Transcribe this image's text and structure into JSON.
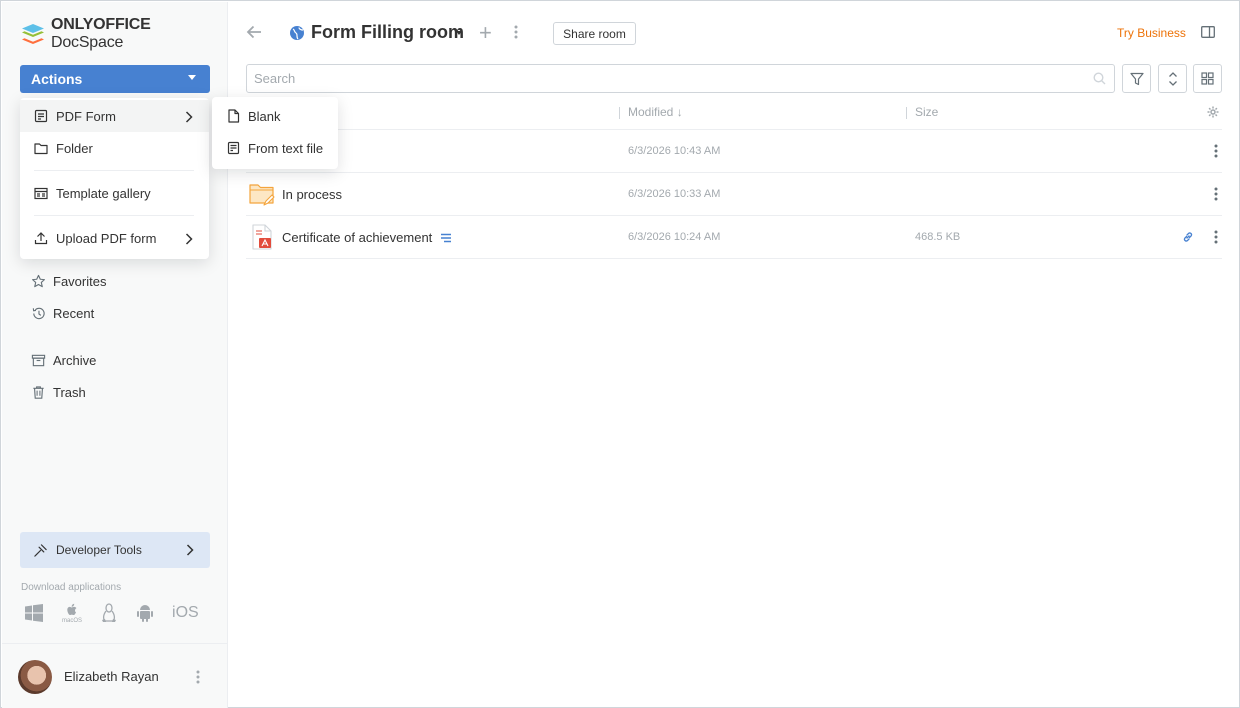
{
  "app": {
    "brand_bold": "ONLYOFFICE",
    "brand_regular": " DocSpace"
  },
  "sidebar": {
    "actions_label": "Actions",
    "nav": [
      {
        "label": "Favorites",
        "icon": "star-icon"
      },
      {
        "label": "Recent",
        "icon": "recent-icon"
      },
      {
        "label": "Archive",
        "icon": "archive-icon"
      },
      {
        "label": "Trash",
        "icon": "trash-icon"
      }
    ],
    "developer_tools": "Developer Tools",
    "download_label": "Download applications",
    "download_apps": [
      "windows-icon",
      "macos-icon",
      "linux-icon",
      "android-icon",
      "iOS"
    ],
    "macos_caption": "macOS",
    "ios_label": "iOS",
    "user_name": "Elizabeth Rayan"
  },
  "actions_menu": {
    "items": [
      {
        "label": "PDF Form",
        "icon": "pdf-form-icon",
        "has_submenu": true
      },
      {
        "label": "Folder",
        "icon": "folder-icon",
        "has_submenu": false
      },
      {
        "label": "Template gallery",
        "icon": "template-gallery-icon",
        "has_submenu": false
      },
      {
        "label": "Upload PDF form",
        "icon": "upload-icon",
        "has_submenu": true
      }
    ],
    "submenu": [
      {
        "label": "Blank",
        "icon": "blank-file-icon"
      },
      {
        "label": "From text file",
        "icon": "from-text-file-icon"
      }
    ]
  },
  "header": {
    "room_title": "Form Filling room",
    "share_room": "Share room",
    "try_business": "Try Business"
  },
  "search": {
    "placeholder": "Search"
  },
  "table": {
    "columns": {
      "modified": "Modified",
      "size": "Size"
    },
    "rows": [
      {
        "name": "",
        "modified": "6/3/2026 10:43 AM",
        "size": "",
        "type": "folder"
      },
      {
        "name": "In process",
        "modified": "6/3/2026 10:33 AM",
        "size": "",
        "type": "folder"
      },
      {
        "name": "Certificate of achievement",
        "modified": "6/3/2026 10:24 AM",
        "size": "468.5 KB",
        "type": "pdf"
      }
    ]
  },
  "colors": {
    "accent": "#4781d1",
    "try_business": "#ed7309",
    "muted": "#a3a9ae",
    "devtools_bg": "#dde7f5"
  }
}
